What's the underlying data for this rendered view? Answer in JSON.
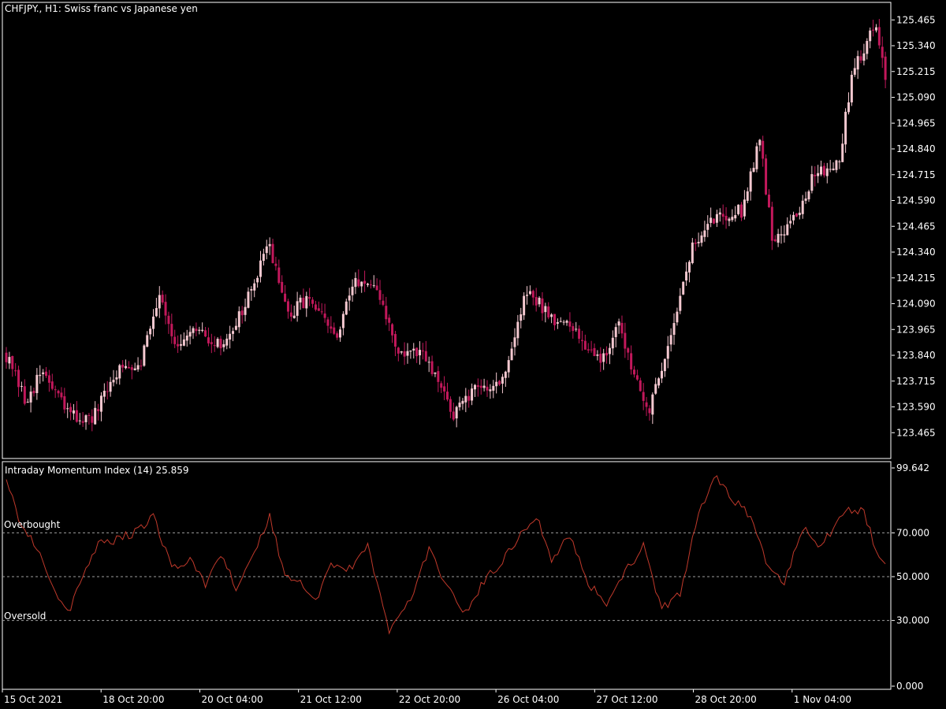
{
  "window": {
    "symbol": "CHFJPY.",
    "timeframe": "H1",
    "description": "Swiss franc vs Japanese yen",
    "title_text": "CHFJPY., H1:  Swiss franc vs Japanese yen"
  },
  "indicator": {
    "title_text": "Intraday Momentum Index (14) 25.859",
    "name": "Intraday Momentum Index",
    "period": 14,
    "current_value": 25.859,
    "overbought_label": "Overbought",
    "oversold_label": "Oversold",
    "levels": [
      70,
      50,
      30
    ]
  },
  "colors": {
    "background": "#000000",
    "bull_candle": "#f4c8d0",
    "bear_candle": "#c2185b",
    "indicator_line": "#c0392b",
    "axis_text": "#ffffff",
    "grid_dash": "#9e9e9e"
  },
  "chart_data": [
    {
      "type": "candlestick",
      "title": "CHFJPY., H1:  Swiss franc vs Japanese yen",
      "ylim": [
        123.34,
        125.55
      ],
      "y_ticks": [
        125.465,
        125.34,
        125.215,
        125.09,
        124.965,
        124.84,
        124.715,
        124.59,
        124.465,
        124.34,
        124.215,
        124.09,
        123.965,
        123.84,
        123.715,
        123.59,
        123.465
      ],
      "y_tick_labels": [
        "125.465",
        "125.340",
        "125.215",
        "125.090",
        "124.965",
        "124.840",
        "124.715",
        "124.590",
        "124.465",
        "124.340",
        "124.215",
        "124.090",
        "123.965",
        "123.840",
        "123.715",
        "123.590",
        "123.465"
      ],
      "x_tick_labels": [
        "15 Oct 2021",
        "18 Oct 20:00",
        "20 Oct 04:00",
        "21 Oct 12:00",
        "22 Oct 20:00",
        "26 Oct 04:00",
        "27 Oct 12:00",
        "28 Oct 20:00",
        "1 Nov 04:00"
      ],
      "close_keypoints": [
        [
          0,
          123.84
        ],
        [
          6,
          123.62
        ],
        [
          12,
          123.76
        ],
        [
          20,
          123.56
        ],
        [
          28,
          123.52
        ],
        [
          36,
          123.76
        ],
        [
          44,
          123.82
        ],
        [
          50,
          124.15
        ],
        [
          56,
          123.86
        ],
        [
          62,
          123.96
        ],
        [
          70,
          123.88
        ],
        [
          78,
          124.08
        ],
        [
          86,
          124.38
        ],
        [
          92,
          124.02
        ],
        [
          98,
          124.12
        ],
        [
          108,
          123.92
        ],
        [
          114,
          124.22
        ],
        [
          122,
          124.12
        ],
        [
          128,
          123.85
        ],
        [
          136,
          123.84
        ],
        [
          146,
          123.56
        ],
        [
          154,
          123.68
        ],
        [
          162,
          123.72
        ],
        [
          170,
          124.15
        ],
        [
          178,
          124.03
        ],
        [
          186,
          123.95
        ],
        [
          194,
          123.82
        ],
        [
          200,
          123.97
        ],
        [
          210,
          123.56
        ],
        [
          216,
          123.9
        ],
        [
          224,
          124.36
        ],
        [
          232,
          124.52
        ],
        [
          240,
          124.54
        ],
        [
          246,
          124.9
        ],
        [
          250,
          124.4
        ],
        [
          258,
          124.52
        ],
        [
          264,
          124.72
        ],
        [
          272,
          124.78
        ],
        [
          276,
          125.2
        ],
        [
          284,
          125.46
        ],
        [
          287,
          125.18
        ]
      ]
    },
    {
      "type": "line",
      "title": "Intraday Momentum Index (14) 25.859",
      "ylim": [
        0,
        99.642
      ],
      "y_ticks": [
        99.642,
        70,
        50,
        30,
        0
      ],
      "y_tick_labels": [
        "99.642",
        "70.000",
        "50.000",
        "30.000",
        "0.000"
      ],
      "series": [
        {
          "name": "Intraday Momentum Index (14)",
          "keypoints": [
            [
              0,
              95
            ],
            [
              5,
              73
            ],
            [
              10,
              64
            ],
            [
              15,
              45
            ],
            [
              20,
              33
            ],
            [
              25,
              50
            ],
            [
              30,
              65
            ],
            [
              36,
              67
            ],
            [
              42,
              70
            ],
            [
              48,
              78
            ],
            [
              54,
              54
            ],
            [
              60,
              57
            ],
            [
              65,
              47
            ],
            [
              70,
              61
            ],
            [
              75,
              45
            ],
            [
              80,
              57
            ],
            [
              86,
              78
            ],
            [
              91,
              50
            ],
            [
              96,
              48
            ],
            [
              101,
              38
            ],
            [
              106,
              57
            ],
            [
              111,
              52
            ],
            [
              118,
              64
            ],
            [
              125,
              25
            ],
            [
              132,
              40
            ],
            [
              138,
              62
            ],
            [
              144,
              46
            ],
            [
              150,
              33
            ],
            [
              156,
              48
            ],
            [
              162,
              57
            ],
            [
              168,
              70
            ],
            [
              173,
              78
            ],
            [
              178,
              58
            ],
            [
              184,
              69
            ],
            [
              190,
              47
            ],
            [
              196,
              38
            ],
            [
              202,
              52
            ],
            [
              208,
              64
            ],
            [
              214,
              35
            ],
            [
              220,
              42
            ],
            [
              226,
              80
            ],
            [
              232,
              96
            ],
            [
              238,
              84
            ],
            [
              244,
              76
            ],
            [
              248,
              55
            ],
            [
              254,
              47
            ],
            [
              260,
              72
            ],
            [
              266,
              64
            ],
            [
              274,
              80
            ],
            [
              280,
              80
            ],
            [
              284,
              61
            ],
            [
              287,
              55
            ]
          ]
        }
      ]
    }
  ]
}
